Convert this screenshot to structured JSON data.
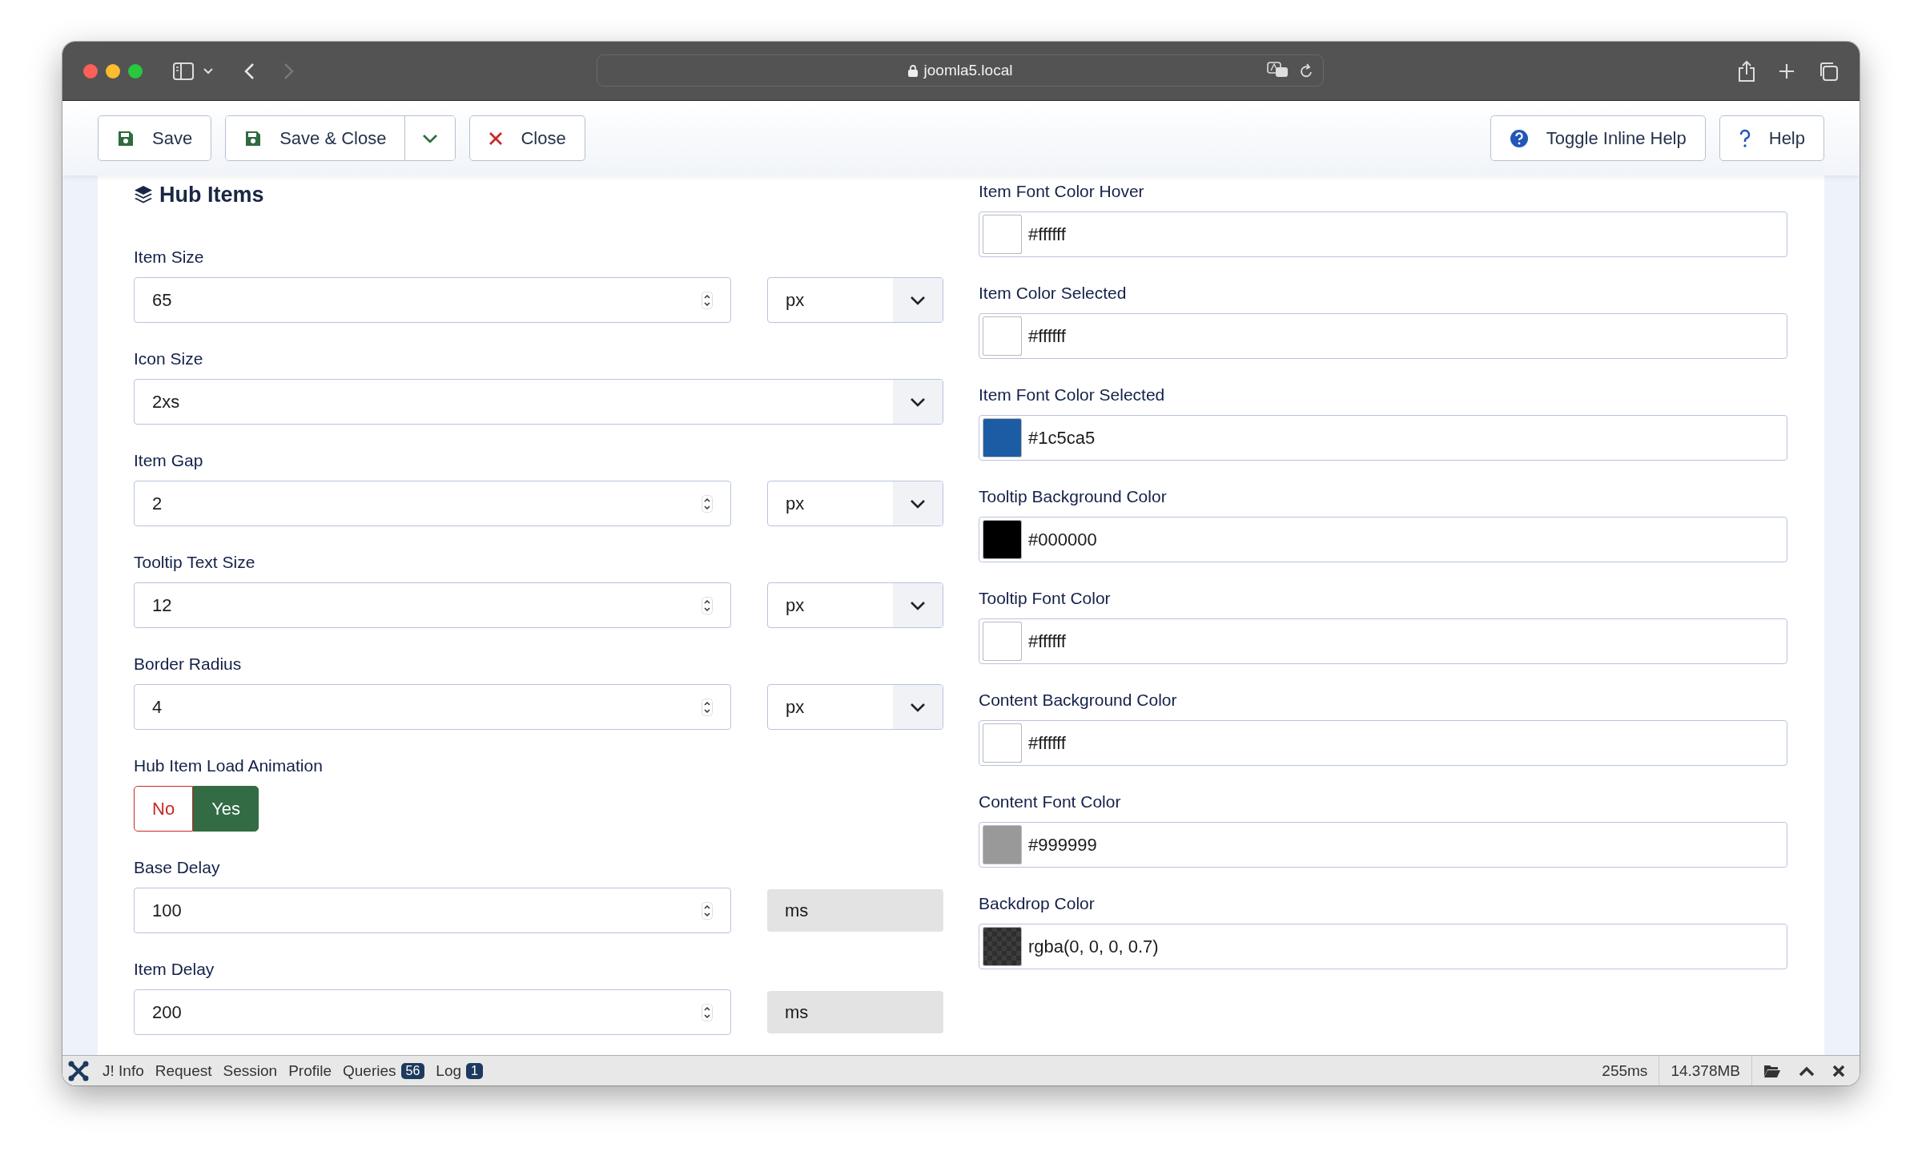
{
  "browser": {
    "url": "joomla5.local"
  },
  "toolbar": {
    "left": [
      {
        "label": "Save",
        "kind": "save"
      },
      {
        "label": "Save & Close",
        "kind": "save_split"
      },
      {
        "label": "Close",
        "kind": "close"
      }
    ],
    "right": [
      {
        "label": "Toggle Inline Help",
        "kind": "help_circle"
      },
      {
        "label": "Help",
        "kind": "help"
      }
    ]
  },
  "section": {
    "title": "Hub Items"
  },
  "left_fields": [
    {
      "kind": "number_unit",
      "label": "Item Size",
      "value": "65",
      "unit": "px"
    },
    {
      "kind": "select",
      "label": "Icon Size",
      "value": "2xs"
    },
    {
      "kind": "number_unit",
      "label": "Item Gap",
      "value": "2",
      "unit": "px"
    },
    {
      "kind": "number_unit",
      "label": "Tooltip Text Size",
      "value": "12",
      "unit": "px"
    },
    {
      "kind": "number_unit",
      "label": "Border Radius",
      "value": "4",
      "unit": "px"
    },
    {
      "kind": "toggle",
      "label": "Hub Item Load Animation",
      "options": [
        {
          "label": "No",
          "selected": false
        },
        {
          "label": "Yes",
          "selected": true
        }
      ]
    },
    {
      "kind": "number_suffix",
      "label": "Base Delay",
      "value": "100",
      "unit": "ms"
    },
    {
      "kind": "number_suffix",
      "label": "Item Delay",
      "value": "200",
      "unit": "ms"
    }
  ],
  "right_fields": [
    {
      "label": "Item Font Color Hover",
      "value": "#ffffff"
    },
    {
      "label": "Item Color Selected",
      "value": "#ffffff"
    },
    {
      "label": "Item Font Color Selected",
      "value": "#1c5ca5"
    },
    {
      "label": "Tooltip Background Color",
      "value": "#000000"
    },
    {
      "label": "Tooltip Font Color",
      "value": "#ffffff"
    },
    {
      "label": "Content Background Color",
      "value": "#ffffff"
    },
    {
      "label": "Content Font Color",
      "value": "#999999"
    },
    {
      "label": "Backdrop Color",
      "value": "rgba(0, 0, 0, 0.7)"
    }
  ],
  "debug_bar": {
    "items": [
      {
        "label": "J! Info"
      },
      {
        "label": "Request"
      },
      {
        "label": "Session"
      },
      {
        "label": "Profile"
      },
      {
        "label": "Queries",
        "badge": "56"
      },
      {
        "label": "Log",
        "badge": "1"
      }
    ],
    "time": "255ms",
    "memory": "14.378MB"
  }
}
